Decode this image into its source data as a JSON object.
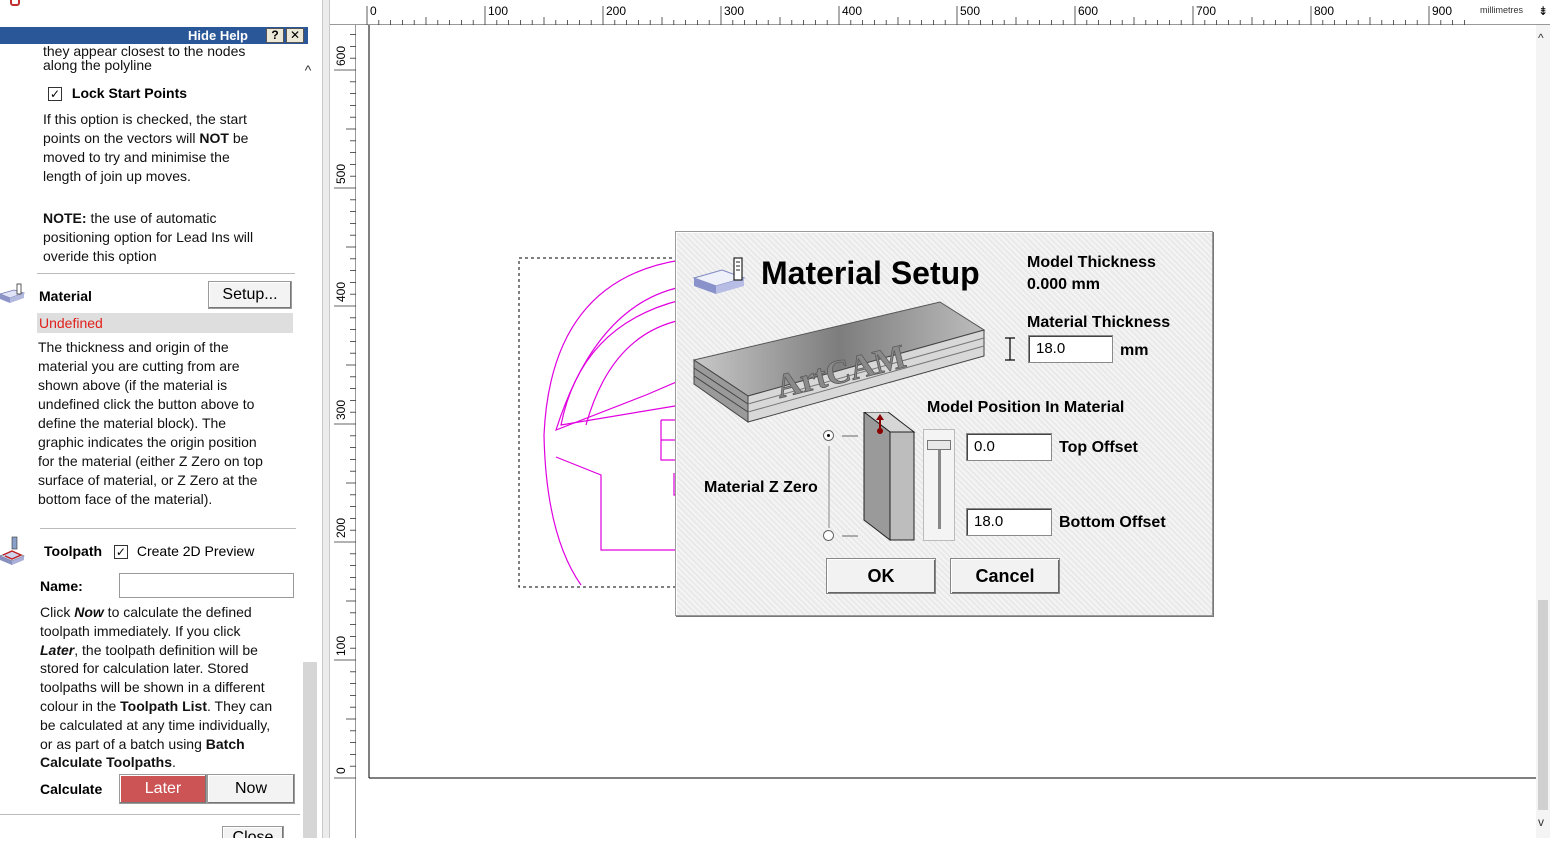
{
  "help": {
    "hide_label": "Hide Help",
    "help_q": "?",
    "close_x": "✕",
    "intro_line1": "they appear closest to the nodes",
    "intro_line2": "along the polyline",
    "lock_start_label": "Lock Start Points",
    "lock_start_desc_1": "If this option is checked, the start",
    "lock_start_desc_2a": "points on the vectors will ",
    "lock_start_desc_2b": "NOT",
    "lock_start_desc_2c": " be",
    "lock_start_desc_3": "moved to try and minimise the",
    "lock_start_desc_4": "length of join up moves.",
    "note_bold": "NOTE:",
    "note_rest_1": " the use of automatic",
    "note_line2": "positioning option for Lead Ins will",
    "note_line3": "overide this option"
  },
  "material": {
    "label": "Material",
    "setup_button": "Setup...",
    "status": "Undefined",
    "desc": [
      "The thickness and origin of the",
      "material you are cutting from are",
      "shown above (if the material is",
      "undefined click the button above to",
      "define the material block). The",
      "graphic indicates the origin position",
      "for the material (either Z Zero on top",
      "surface of material, or Z Zero at the",
      "bottom face of the material)."
    ]
  },
  "toolpath": {
    "label": "Toolpath",
    "preview_label": "Create 2D Preview",
    "name_label": "Name:",
    "name_value": "",
    "desc_1a": "Click ",
    "desc_1b": "Now",
    "desc_1c": " to calculate the defined",
    "desc_2": "toolpath immediately. If you click",
    "desc_3a": "Later",
    "desc_3b": ", the toolpath definition will be",
    "desc_4": "stored for calculation later. Stored",
    "desc_5": "toolpaths will be shown in a different",
    "desc_6a": "colour in the ",
    "desc_6b": "Toolpath List",
    "desc_6c": ". They can",
    "desc_7": "be calculated at any time individually,",
    "desc_8a": "or as part of a batch using ",
    "desc_8b": "Batch",
    "desc_9": "Calculate Toolpaths",
    "desc_9b": ".",
    "calculate_label": "Calculate",
    "later_button": "Later",
    "now_button": "Now",
    "close_button": "Close"
  },
  "ruler": {
    "top_ticks": [
      "0",
      "100",
      "200",
      "300",
      "400",
      "500",
      "600",
      "700",
      "800",
      "900"
    ],
    "left_ticks": [
      "600",
      "500",
      "400",
      "300",
      "200",
      "100",
      "0"
    ],
    "unit": "millimetres"
  },
  "dialog": {
    "title": "Material Setup",
    "model_thickness_label": "Model Thickness",
    "model_thickness_value": "0.000 mm",
    "material_thickness_label": "Material Thickness",
    "material_thickness_value": "18.0",
    "mm_label": "mm",
    "position_label": "Model Position In Material",
    "top_offset_value": "0.0",
    "top_offset_label": "Top Offset",
    "bottom_offset_value": "18.0",
    "bottom_offset_label": "Bottom Offset",
    "z_zero_label": "Material Z Zero",
    "ok_button": "OK",
    "cancel_button": "Cancel",
    "slab_text": "ArtCAM"
  },
  "colors": {
    "help_titlebar": "#2a5798",
    "undefined_text": "#e0201c",
    "later_button": "#cd5454",
    "drawing_vectors": "#e000e0"
  }
}
